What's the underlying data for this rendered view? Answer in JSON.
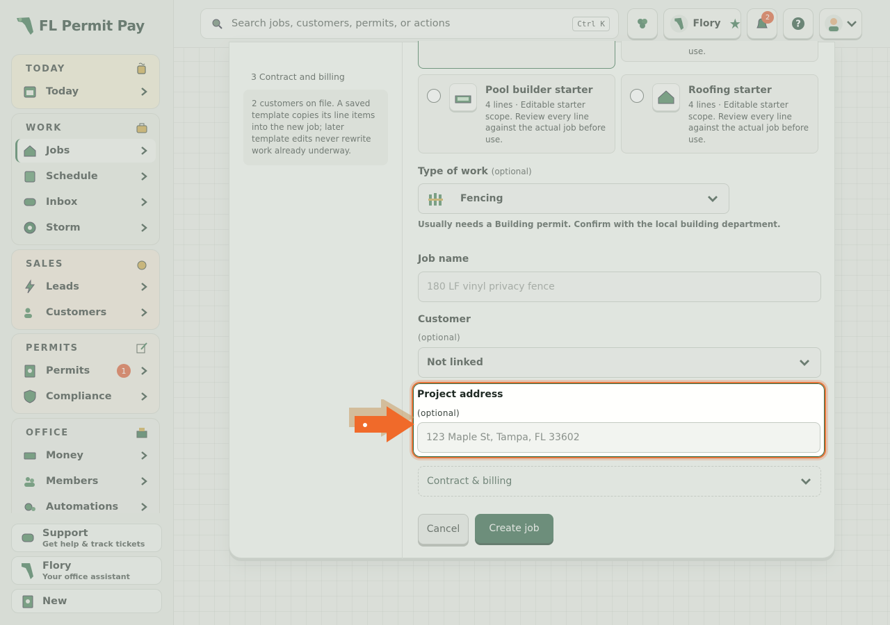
{
  "brand": {
    "title": "FL Permit Pay"
  },
  "sidebar": {
    "groups": [
      {
        "title": "TODAY",
        "items": [
          {
            "label": "Today"
          }
        ]
      },
      {
        "title": "WORK",
        "items": [
          {
            "label": "Jobs"
          },
          {
            "label": "Schedule"
          },
          {
            "label": "Inbox"
          },
          {
            "label": "Storm"
          }
        ]
      },
      {
        "title": "SALES",
        "items": [
          {
            "label": "Leads"
          },
          {
            "label": "Customers"
          }
        ]
      },
      {
        "title": "PERMITS",
        "items": [
          {
            "label": "Permits",
            "badge": "1"
          },
          {
            "label": "Compliance"
          }
        ]
      },
      {
        "title": "OFFICE",
        "items": [
          {
            "label": "Money"
          },
          {
            "label": "Members"
          },
          {
            "label": "Automations"
          }
        ]
      }
    ],
    "footer": {
      "support": {
        "title": "Support",
        "subtitle": "Get help & track tickets"
      },
      "assistant": {
        "title": "Flory",
        "subtitle": "Your office assistant"
      },
      "new": {
        "title": "New"
      }
    }
  },
  "topbar": {
    "search": {
      "placeholder": "Search jobs, customers, permits, or actions",
      "shortcut": "Ctrl K"
    },
    "assistant_label": "Flory",
    "notifications_count": "2"
  },
  "modal": {
    "steps": {
      "step3": "3 Contract and billing"
    },
    "note": "2 customers on file. A saved template copies its line items into the new job; later template edits never rewrite work already underway.",
    "top_card_tail": "use.",
    "templates": [
      {
        "title": "Pool builder starter",
        "desc": "4 lines · Editable starter scope. Review every line against the actual job before use."
      },
      {
        "title": "Roofing starter",
        "desc": "4 lines · Editable starter scope. Review every line against the actual job before use."
      }
    ],
    "type_of_work": {
      "label": "Type of work",
      "optional": "(optional)",
      "value": "Fencing",
      "hint": "Usually needs a Building permit. Confirm with the local building department."
    },
    "job_name": {
      "label": "Job name",
      "placeholder": "180 LF vinyl privacy fence"
    },
    "customer": {
      "label": "Customer",
      "optional": "(optional)",
      "value": "Not linked"
    },
    "project_address": {
      "label": "Project address",
      "optional": "(optional)",
      "placeholder": "123 Maple St, Tampa, FL 33602"
    },
    "contract_billing": {
      "label": "Contract & billing"
    },
    "actions": {
      "cancel": "Cancel",
      "create": "Create job"
    }
  },
  "colors": {
    "brand_green": "#245a3c",
    "accent_orange": "#e8753b",
    "badge_red": "#d9542b"
  }
}
